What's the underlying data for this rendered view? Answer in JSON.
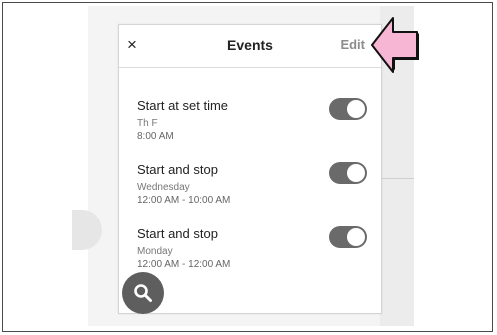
{
  "header": {
    "close_icon": "×",
    "title": "Events",
    "edit_label": "Edit"
  },
  "events": [
    {
      "title": "Start at set time",
      "days": "Th F",
      "time": "8:00 AM",
      "enabled": true
    },
    {
      "title": "Start and stop",
      "days": "Wednesday",
      "time": "12:00 AM - 10:00 AM",
      "enabled": true
    },
    {
      "title": "Start and stop",
      "days": "Monday",
      "time": "12:00 AM - 12:00 AM",
      "enabled": true
    }
  ],
  "icons": {
    "close": "close-icon",
    "search": "search-icon",
    "pointer": "pointer-arrow-icon"
  },
  "colors": {
    "toggle_on": "#6a6a6a",
    "fab": "#5e5e5e",
    "edit_text": "#8c8c8c",
    "arrow_fill": "#f7b6d3"
  }
}
